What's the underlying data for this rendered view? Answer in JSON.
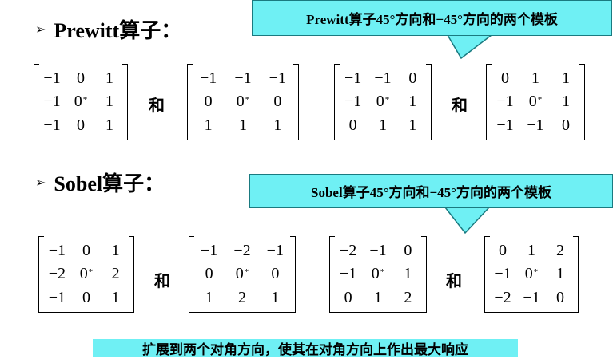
{
  "prewitt": {
    "heading": "Prewitt算子：",
    "callout": "Prewitt算子45°方向和−45°方向的两个模板",
    "and_label": "和",
    "matrices": [
      [
        [
          "−1",
          "0",
          "1"
        ],
        [
          "−1",
          "0",
          "1"
        ],
        [
          "−1",
          "0",
          "1"
        ]
      ],
      [
        [
          "−1",
          "−1",
          "−1"
        ],
        [
          "0",
          "0",
          "0"
        ],
        [
          "1",
          "1",
          "1"
        ]
      ],
      [
        [
          "−1",
          "−1",
          "0"
        ],
        [
          "−1",
          "0",
          "1"
        ],
        [
          "0",
          "1",
          "1"
        ]
      ],
      [
        [
          "0",
          "1",
          "1"
        ],
        [
          "−1",
          "0",
          "1"
        ],
        [
          "−1",
          "−1",
          "0"
        ]
      ]
    ]
  },
  "sobel": {
    "heading": "Sobel算子：",
    "callout": "Sobel算子45°方向和−45°方向的两个模板",
    "and_label": "和",
    "matrices": [
      [
        [
          "−1",
          "0",
          "1"
        ],
        [
          "−2",
          "0",
          "2"
        ],
        [
          "−1",
          "0",
          "1"
        ]
      ],
      [
        [
          "−1",
          "−2",
          "−1"
        ],
        [
          "0",
          "0",
          "0"
        ],
        [
          "1",
          "2",
          "1"
        ]
      ],
      [
        [
          "−2",
          "−1",
          "0"
        ],
        [
          "−1",
          "0",
          "1"
        ],
        [
          "0",
          "1",
          "2"
        ]
      ],
      [
        [
          "0",
          "1",
          "2"
        ],
        [
          "−1",
          "0",
          "1"
        ],
        [
          "−2",
          "−1",
          "0"
        ]
      ]
    ]
  },
  "center_marker": "*",
  "bullet": "➢",
  "footer_note": "扩展到两个对角方向，使其在对角方向上作出最大响应",
  "colors": {
    "callout_fill": "#6ff0f4",
    "callout_border": "#1a7a80"
  }
}
